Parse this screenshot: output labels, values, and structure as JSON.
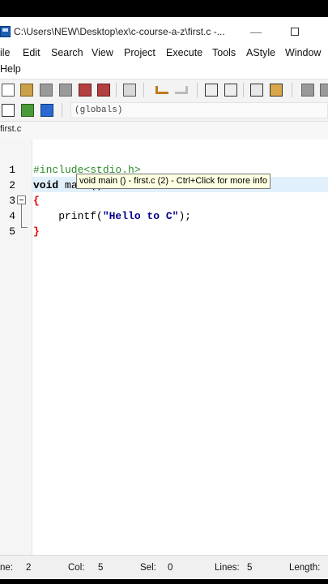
{
  "window": {
    "title": "C:\\Users\\NEW\\Desktop\\ex\\c-course-a-z\\first.c -...",
    "min_glyph": "—"
  },
  "menu": {
    "file": "ile",
    "edit": "Edit",
    "search": "Search",
    "view": "View",
    "project": "Project",
    "execute": "Execute",
    "tools": "Tools",
    "astyle": "AStyle",
    "window": "Window",
    "help": "Help"
  },
  "toolbar": {
    "scope_value": "(globals)"
  },
  "tabs": [
    {
      "label": "first.c"
    }
  ],
  "editor": {
    "line_numbers": [
      "1",
      "2",
      "3",
      "4",
      "5"
    ],
    "lines": {
      "l1": "#include<stdio.h>",
      "l2_kw": "void",
      "l2_rest": " main()",
      "l3": "{",
      "l4_fn": "    printf(",
      "l4_str": "\"Hello to C\"",
      "l4_end": ");",
      "l5": "}"
    },
    "tooltip": "void main () - first.c (2) - Ctrl+Click for more info"
  },
  "status": {
    "line_label": "ne:",
    "line_value": "2",
    "col_label": "Col:",
    "col_value": "5",
    "sel_label": "Sel:",
    "sel_value": "0",
    "lines_label": "Lines:",
    "lines_value": "5",
    "length_label": "Length:"
  },
  "colors": {
    "preprocessor": "#2e8b2e",
    "brace": "#dd0000",
    "string": "#00008b",
    "current_line": "#e1f0fb",
    "tooltip_bg": "#ffffe1"
  }
}
